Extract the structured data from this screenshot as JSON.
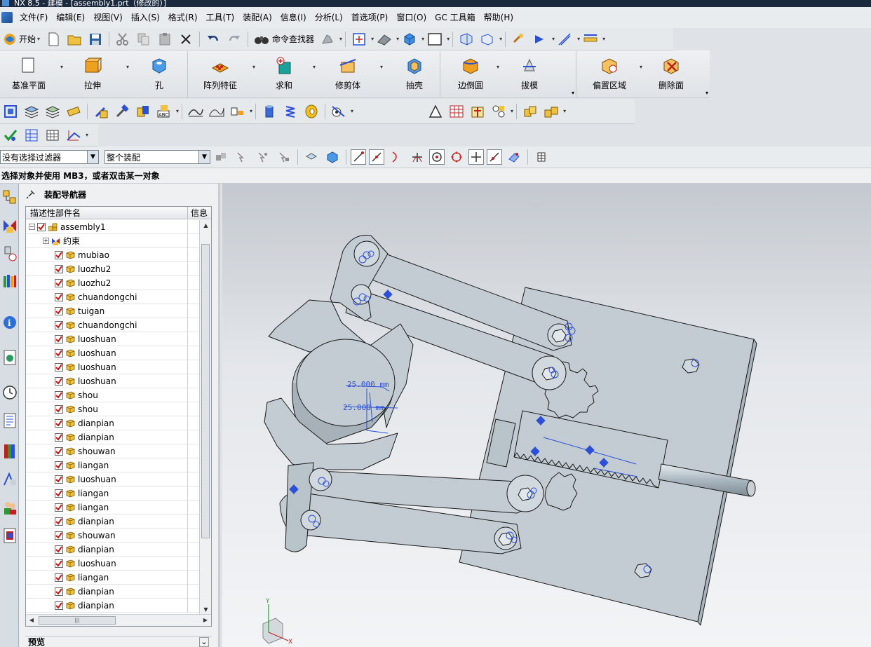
{
  "window": {
    "title": "NX 8.5 - 建模 - [assembly1.prt（修改的）]"
  },
  "menu": {
    "items": [
      "文件(F)",
      "编辑(E)",
      "视图(V)",
      "插入(S)",
      "格式(R)",
      "工具(T)",
      "装配(A)",
      "信息(I)",
      "分析(L)",
      "首选项(P)",
      "窗口(O)",
      "GC 工具箱",
      "帮助(H)"
    ]
  },
  "toolbar1": {
    "start_label": "开始",
    "command_finder_label": "命令查找器"
  },
  "feature_toolbar": {
    "items": [
      "基准平面",
      "拉伸",
      "孔",
      "阵列特征",
      "求和",
      "修剪体",
      "抽壳",
      "边倒圆",
      "拔模",
      "偏置区域",
      "删除面"
    ]
  },
  "selection_bar": {
    "filter_value": "没有选择过滤器",
    "scope_value": "整个装配"
  },
  "status": {
    "prompt": "选择对象并使用 MB3，或者双击某一对象"
  },
  "navigator": {
    "title": "装配导航器",
    "col_name": "描述性部件名",
    "col_info": "信息",
    "root": "assembly1",
    "constraints": "约束",
    "parts": [
      "mubiao",
      "luozhu2",
      "luozhu2",
      "chuandongchi",
      "tuigan",
      "chuandongchi",
      "luoshuan",
      "luoshuan",
      "luoshuan",
      "luoshuan",
      "shou",
      "shou",
      "dianpian",
      "dianpian",
      "shouwan",
      "liangan",
      "luoshuan",
      "liangan",
      "liangan",
      "dianpian",
      "shouwan",
      "dianpian",
      "luoshuan",
      "liangan",
      "dianpian",
      "dianpian"
    ],
    "preview_label": "预览"
  },
  "viewport": {
    "dimension_1": "25.000 mm",
    "dimension_2": "25.000 mm",
    "triad_y": "Y",
    "triad_x": "X"
  },
  "colors": {
    "part_fill": "#c3ccd3",
    "part_edge": "#1a1a1a",
    "constraint_blue": "#2b4fd8",
    "check_red": "#d01010"
  }
}
